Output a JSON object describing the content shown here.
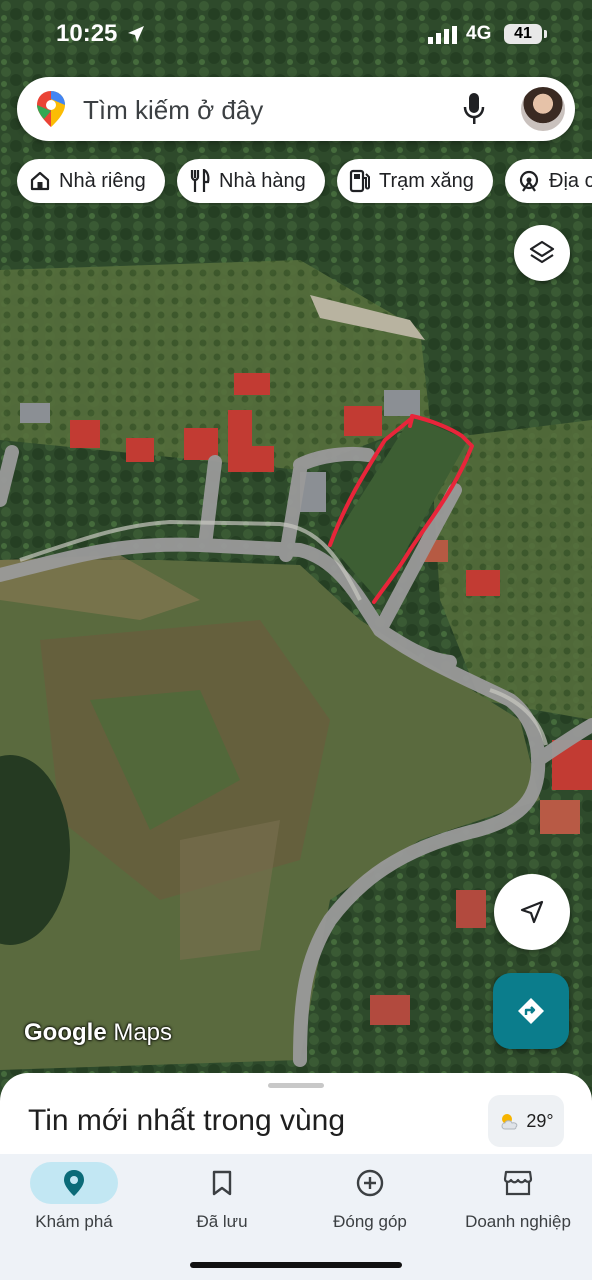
{
  "status_bar": {
    "time": "10:25",
    "network": "4G",
    "battery": "41"
  },
  "search": {
    "placeholder": "Tìm kiếm ở đây"
  },
  "chips": [
    {
      "label": "Nhà riêng",
      "icon": "home-icon"
    },
    {
      "label": "Nhà hàng",
      "icon": "restaurant-icon"
    },
    {
      "label": "Trạm xăng",
      "icon": "gas-station-icon"
    },
    {
      "label": "Địa c",
      "icon": "attractions-icon"
    }
  ],
  "map": {
    "attribution_brand": "Google",
    "attribution_product": "Maps",
    "view": "satellite",
    "annotation_color": "#e8253a"
  },
  "sheet": {
    "title": "Tin mới nhất trong vùng",
    "weather": "29°"
  },
  "nav": [
    {
      "label": "Khám phá",
      "icon": "explore-pin-icon",
      "active": true
    },
    {
      "label": "Đã lưu",
      "icon": "bookmark-icon",
      "active": false
    },
    {
      "label": "Đóng góp",
      "icon": "add-circle-icon",
      "active": false
    },
    {
      "label": "Doanh nghiệp",
      "icon": "storefront-icon",
      "active": false
    }
  ],
  "colors": {
    "accent": "#0b7d8c",
    "nav_active_bg": "#c2e7f3"
  }
}
